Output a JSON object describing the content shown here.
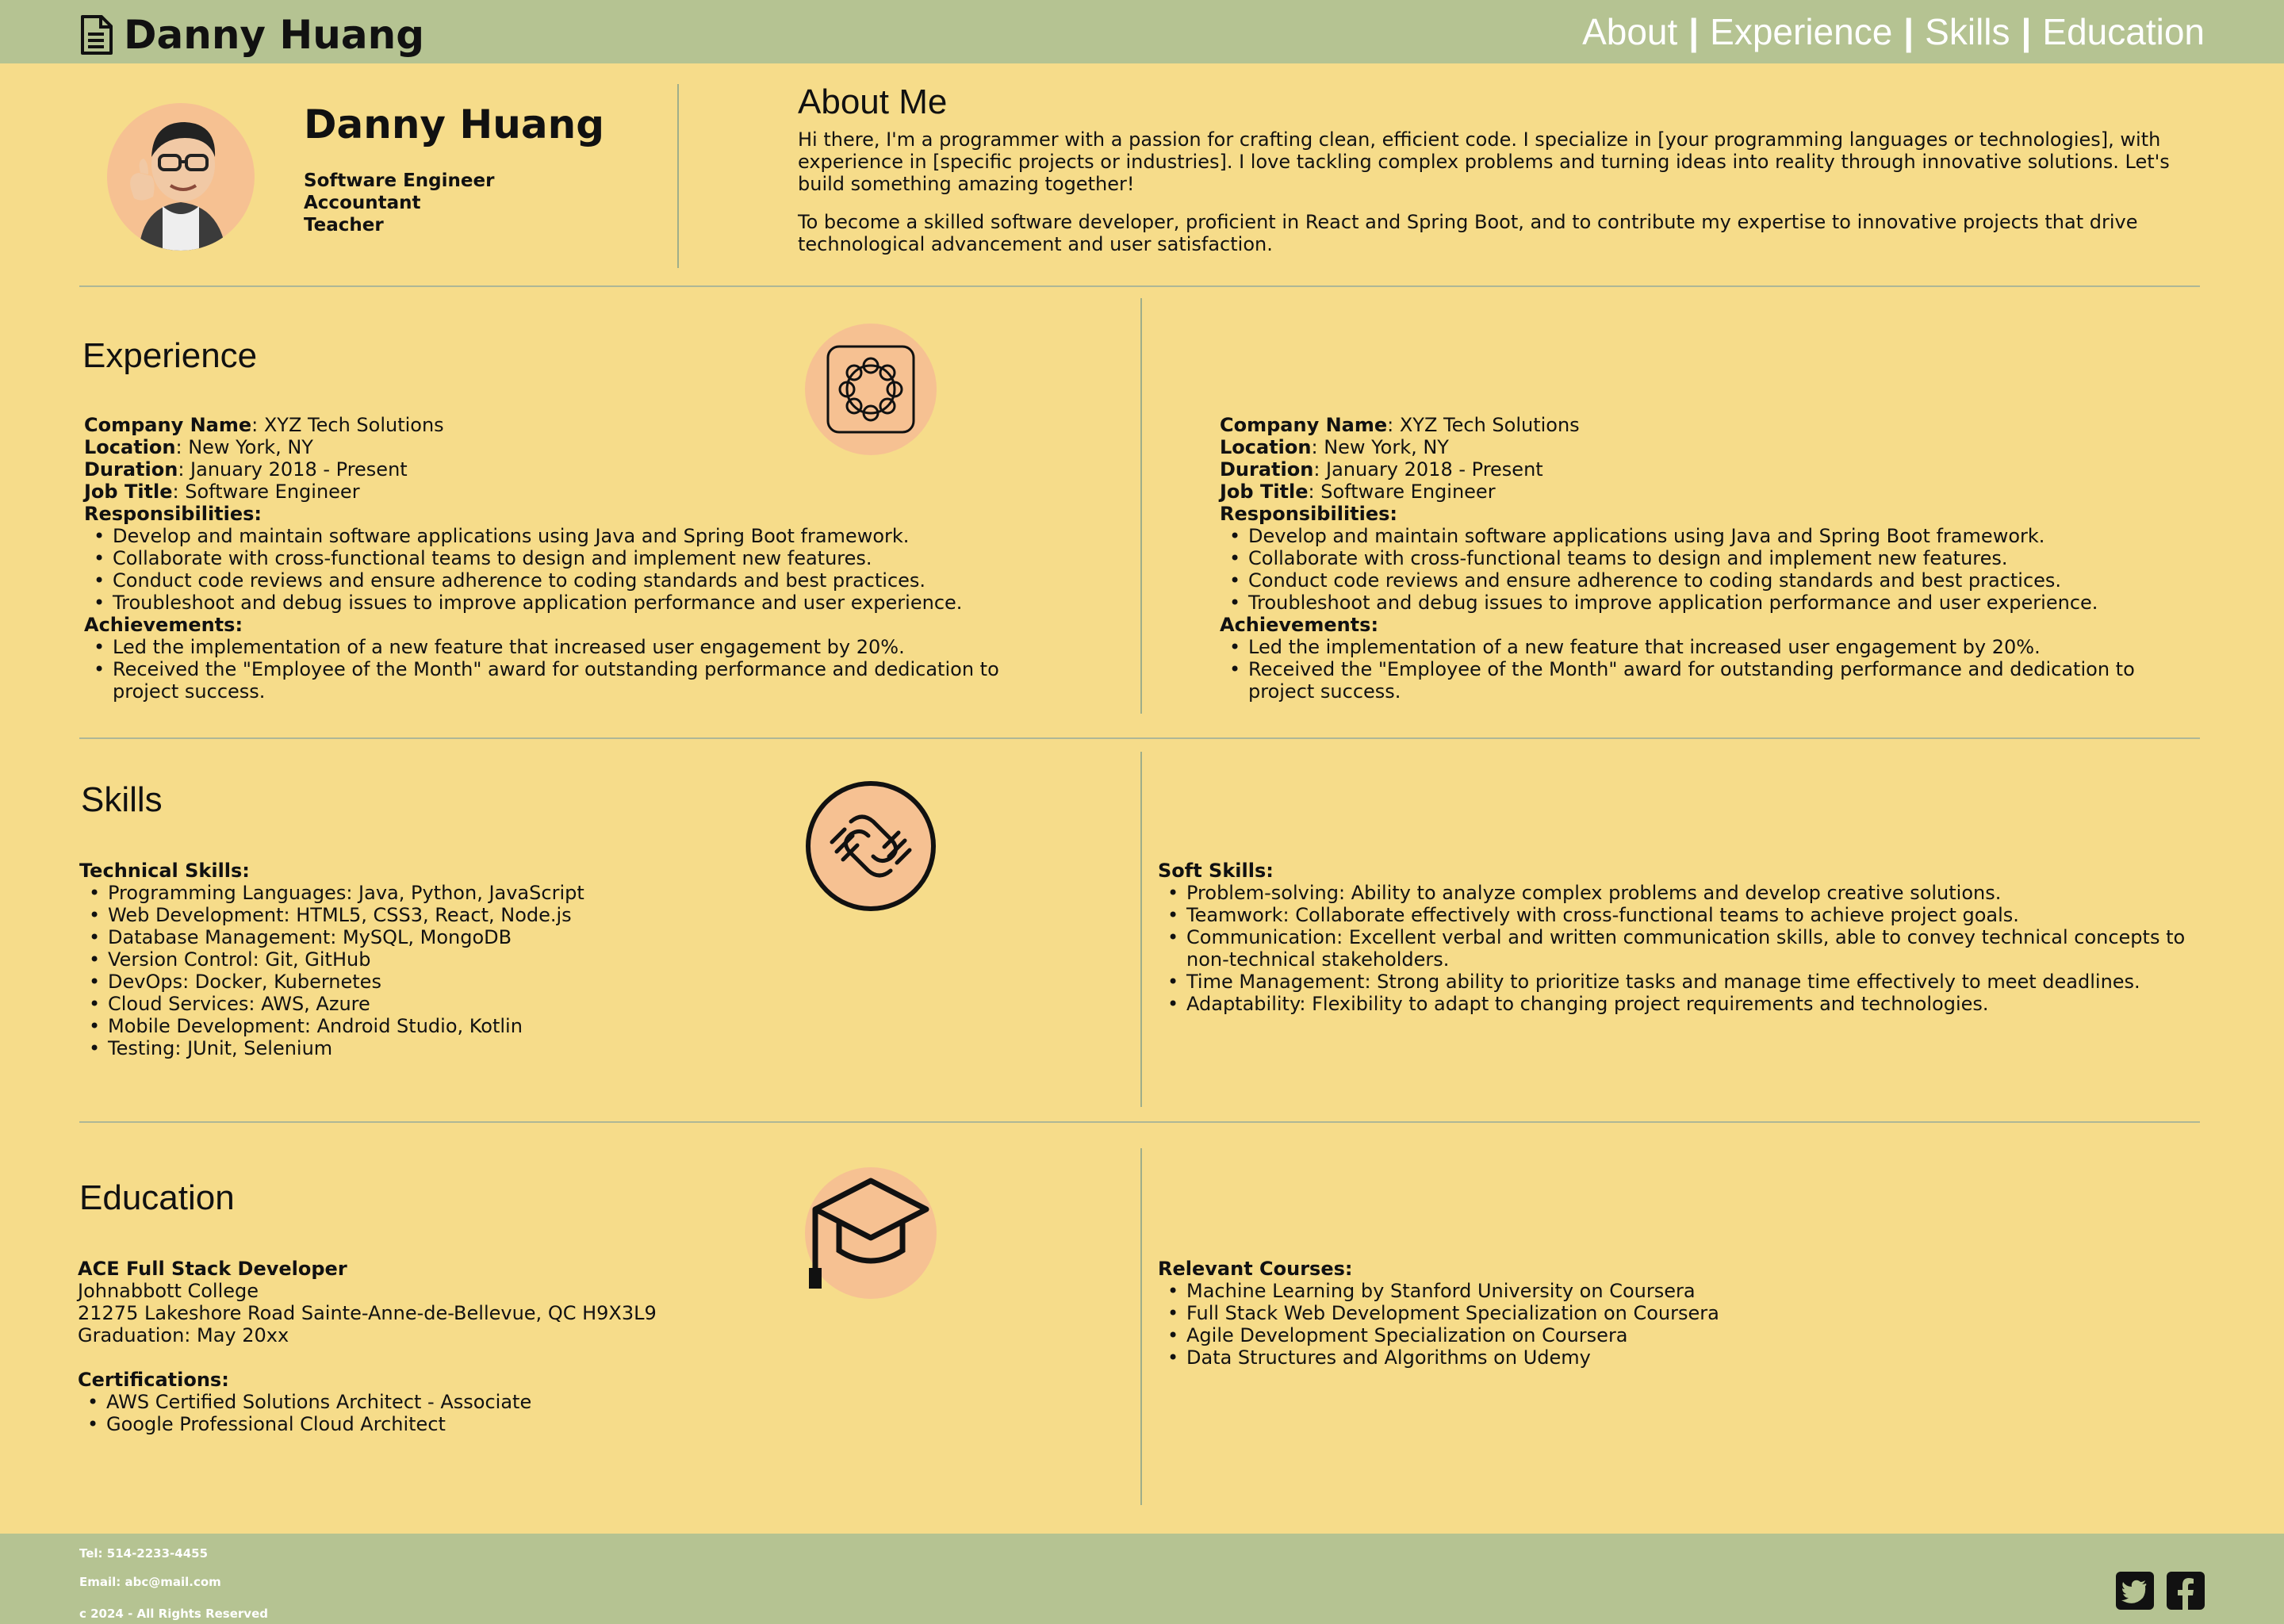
{
  "header": {
    "brand_icon": "document-icon",
    "brand_name": "Danny Huang",
    "nav": [
      {
        "label": "About"
      },
      {
        "label": "Experience"
      },
      {
        "label": "Skills"
      },
      {
        "label": "Education"
      }
    ],
    "separator": "|"
  },
  "profile": {
    "name": "Danny Huang",
    "roles": [
      "Software Engineer",
      "Accountant",
      "Teacher"
    ],
    "avatar_icon": "memoji-avatar"
  },
  "about": {
    "title": "About Me",
    "paragraphs": [
      "Hi there, I'm a programmer with a passion for crafting clean, efficient code. I specialize in [your programming languages or technologies], with experience in [specific projects or industries]. I love tackling complex problems and turning ideas into reality through innovative solutions. Let's build something amazing together!",
      "To become a skilled software developer, proficient in React and Spring Boot, and to contribute my expertise to innovative projects that drive technological advancement and user satisfaction."
    ]
  },
  "experience": {
    "title": "Experience",
    "icon": "aperture-icon",
    "jobs": [
      {
        "company_label": "Company Name",
        "company": ": XYZ Tech Solutions",
        "location_label": "Location",
        "location": ": New York, NY",
        "duration_label": "Duration",
        "duration": ": January 2018 - Present",
        "title_label": "Job Title",
        "title": ": Software Engineer",
        "responsibilities_label": "Responsibilities:",
        "responsibilities": [
          "Develop and maintain software applications using Java and Spring Boot framework.",
          "Collaborate with cross-functional teams to design and implement new features.",
          "Conduct code reviews and ensure adherence to coding standards and best practices.",
          "Troubleshoot and debug issues to improve application performance and user experience."
        ],
        "achievements_label": "Achievements:",
        "achievements": [
          "Led the implementation of a new feature that increased user engagement by 20%.",
          "Received the \"Employee of the Month\" award for outstanding performance and dedication to project success."
        ]
      },
      {
        "company_label": "Company Name",
        "company": ": XYZ Tech Solutions",
        "location_label": "Location",
        "location": ": New York, NY",
        "duration_label": "Duration",
        "duration": ": January 2018 - Present",
        "title_label": "Job Title",
        "title": ": Software Engineer",
        "responsibilities_label": "Responsibilities:",
        "responsibilities": [
          "Develop and maintain software applications using Java and Spring Boot framework.",
          "Collaborate with cross-functional teams to design and implement new features.",
          "Conduct code reviews and ensure adherence to coding standards and best practices.",
          "Troubleshoot and debug issues to improve application performance and user experience."
        ],
        "achievements_label": "Achievements:",
        "achievements": [
          "Led the implementation of a new feature that increased user engagement by 20%.",
          "Received the \"Employee of the Month\" award for outstanding performance and dedication to project success."
        ]
      }
    ]
  },
  "skills": {
    "title": "Skills",
    "icon": "handshake-icon",
    "technical_label": "Technical Skills:",
    "technical": [
      "Programming Languages: Java, Python, JavaScript",
      "Web Development: HTML5, CSS3, React, Node.js",
      "Database Management: MySQL, MongoDB",
      "Version Control: Git, GitHub",
      "DevOps: Docker, Kubernetes",
      "Cloud Services: AWS, Azure",
      "Mobile Development: Android Studio, Kotlin",
      "Testing: JUnit, Selenium"
    ],
    "soft_label": "Soft Skills:",
    "soft": [
      "Problem-solving: Ability to analyze complex problems and develop creative solutions.",
      "Teamwork: Collaborate effectively with cross-functional teams to achieve project goals.",
      "Communication: Excellent verbal and written communication skills, able to convey technical concepts to non-technical stakeholders.",
      "Time Management: Strong ability to prioritize tasks and manage time effectively to meet deadlines.",
      "Adaptability: Flexibility to adapt to changing project requirements and technologies."
    ]
  },
  "education": {
    "title": "Education",
    "icon": "graduation-cap-icon",
    "degree": "ACE Full Stack Developer",
    "school": "Johnabbott College",
    "address": "21275 Lakeshore Road Sainte-Anne-de-Bellevue, QC H9X3L9",
    "graduation": "Graduation: May 20xx",
    "certifications_label": "Certifications:",
    "certifications": [
      "AWS Certified Solutions Architect - Associate",
      "Google Professional Cloud Architect"
    ],
    "courses_label": "Relevant Courses:",
    "courses": [
      "Machine Learning by Stanford University on Coursera",
      "Full Stack Web Development Specialization on Coursera",
      "Agile Development Specialization on Coursera",
      "Data Structures and Algorithms on Udemy"
    ]
  },
  "footer": {
    "tel": "Tel: 514-2233-4455",
    "email": "Email: abc@mail.com",
    "copyright": "c 2024 - All Rights Reserved",
    "social": [
      "twitter-icon",
      "facebook-icon"
    ]
  },
  "colors": {
    "background": "#F6DC8A",
    "bars": "#B5C392",
    "accent_circle": "#F6C192"
  }
}
